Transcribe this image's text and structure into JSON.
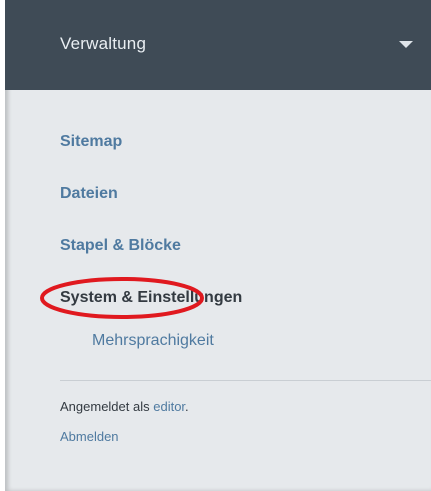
{
  "header": {
    "title": "Verwaltung",
    "dropdown_icon": "caret-down-icon"
  },
  "nav": {
    "items": [
      {
        "label": "Sitemap"
      },
      {
        "label": "Dateien"
      },
      {
        "label": "Stapel & Blöcke"
      },
      {
        "label": "System & Einstellungen",
        "active": true
      }
    ],
    "subitems": [
      {
        "label": "Mehrsprachigkeit"
      }
    ]
  },
  "footer": {
    "logged_in_prefix": "Angemeldet als ",
    "username": "editor",
    "logged_in_suffix": ".",
    "logout_label": "Abmelden"
  },
  "colors": {
    "header_bg": "#3f4b56",
    "panel_bg": "#e6e9ec",
    "link": "#4f7aa0",
    "active_text": "#333a41",
    "annotation": "#e0191f"
  }
}
